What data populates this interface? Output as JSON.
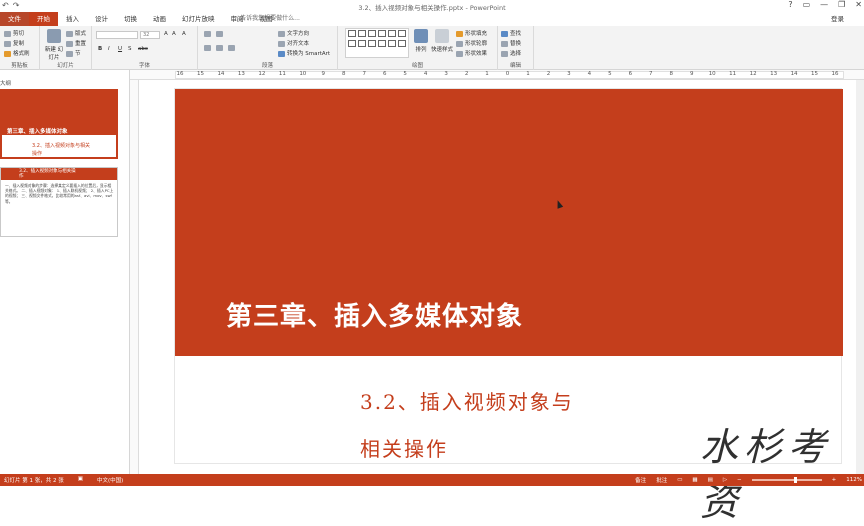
{
  "window": {
    "doc_title": "3.2、插入视频对象与相关操作.pptx - PowerPoint",
    "qat": [
      "↶",
      "↷"
    ],
    "controls": [
      "?",
      "▭",
      "—",
      "❐",
      "✕"
    ]
  },
  "tabs": {
    "file": "文件",
    "items": [
      "开始",
      "插入",
      "设计",
      "切换",
      "动画",
      "幻灯片放映",
      "审阅",
      "视图"
    ],
    "active": "开始",
    "tell_me": "告诉我您想要做什么...",
    "login": "登录"
  },
  "ribbon": {
    "clipboard": {
      "label": "剪贴板",
      "cut": "剪切",
      "copy": "复制",
      "format_painter": "格式刷"
    },
    "slides": {
      "label": "幻灯片",
      "new_slide": "新建\n幻灯片",
      "layout": "版式",
      "reset": "重置",
      "section": "节"
    },
    "font": {
      "label": "字体",
      "font_size": "32",
      "bold": "B",
      "italic": "I",
      "underline": "U",
      "shadow": "S",
      "strike": "abc",
      "grow": "A",
      "shrink": "A",
      "clear": "A"
    },
    "paragraph": {
      "label": "段落",
      "text_direction": "文字方向",
      "align_text": "对齐文本",
      "smartart": "转换为 SmartArt"
    },
    "drawing": {
      "label": "绘图",
      "arrange": "排列",
      "quick_styles": "快速样式",
      "fill": "形状填充",
      "outline": "形状轮廓",
      "effects": "形状效果"
    },
    "editing": {
      "label": "编辑",
      "find": "查找",
      "replace": "替换",
      "select": "选择"
    }
  },
  "ruler": {
    "ticks": [
      "16",
      "15",
      "14",
      "13",
      "12",
      "11",
      "10",
      "9",
      "8",
      "7",
      "6",
      "5",
      "4",
      "3",
      "2",
      "1",
      "0",
      "1",
      "2",
      "3",
      "4",
      "5",
      "6",
      "7",
      "8",
      "9",
      "10",
      "11",
      "12",
      "13",
      "14",
      "15",
      "16"
    ]
  },
  "leftpanel": {
    "outline_label": "大纲",
    "thumb1": {
      "title": "第三章、插入多媒体对象",
      "subtitle": "3.2、插入视频对象与相关操作"
    },
    "thumb2": {
      "title": "3.2、插入视频对象与相关操作",
      "body": "一、插入视频对象的步骤：选择某定义要插入的位置后，显示相关格式。 二、插入视频对象： 1、插入联机视频； 2、插入PC上的视频； 三、视频文件格式，比较常用的asf、avi、mov、swf等。"
    }
  },
  "slide": {
    "title": "第三章、插入多媒体对象",
    "subtitle_line1": "3.2、插入视频对象与",
    "subtitle_line2": "相关操作"
  },
  "watermark": "水杉考资",
  "statusbar": {
    "slide_pos": "幻灯片 第 1 张，共 2 张",
    "lang": "中文(中国)",
    "notes": "备注",
    "comments": "批注",
    "zoom": "112%"
  },
  "colors": {
    "accent": "#c43e1c",
    "subtitle": "#c43e1c"
  }
}
